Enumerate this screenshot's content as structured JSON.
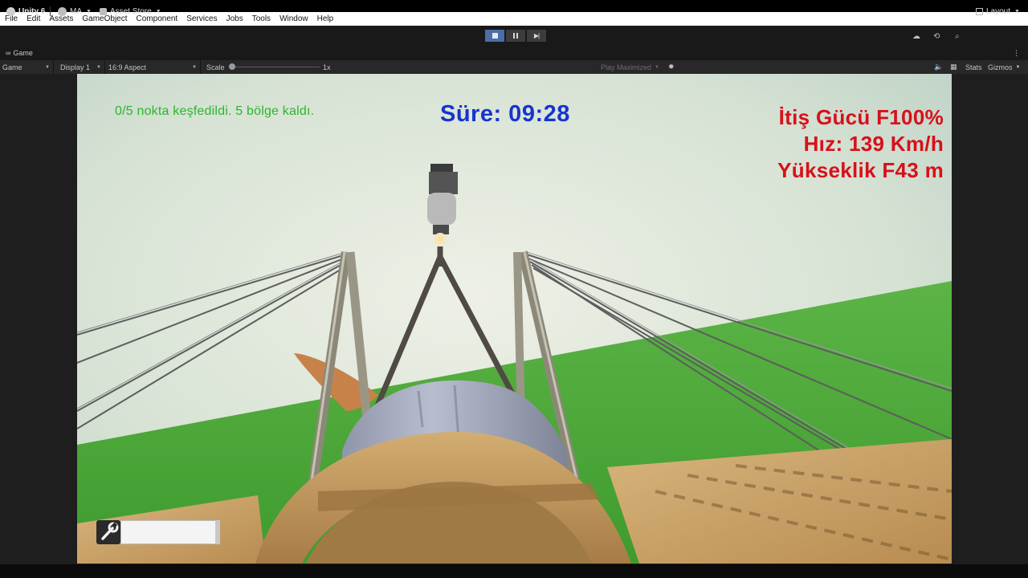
{
  "menu": {
    "items": [
      "File",
      "Edit",
      "Assets",
      "GameObject",
      "Component",
      "Services",
      "Jobs",
      "Tools",
      "Window",
      "Help"
    ]
  },
  "toolbar": {
    "unity_label": "Unity 6",
    "account_label": "MA",
    "asset_store_label": "Asset Store",
    "layout_label": "Layout",
    "play_state": "playing"
  },
  "game_tab": {
    "label": "Game"
  },
  "game_controls": {
    "view_mode": "Game",
    "display": "Display 1",
    "aspect": "16:9 Aspect",
    "scale_label": "Scale",
    "scale_value": "1x",
    "play_mode": "Play Maximized",
    "stats_label": "Stats",
    "gizmos_label": "Gizmos"
  },
  "hud": {
    "discovered_text": "0/5 nokta keşfedildi. 5 bölge kaldı.",
    "timer_text": "Süre: 09:28",
    "thrust_text": "İtiş Gücü F100%",
    "speed_text": "Hız: 139 Km/h",
    "altitude_text": "Yükseklik F43 m",
    "repair_level": 0.0
  },
  "colors": {
    "hud_green": "#2db52d",
    "hud_blue": "#1634d0",
    "hud_red": "#d8101a",
    "sky": "#d9e3d6",
    "ground": "#4eaa37",
    "play_button_active": "#4b6ea8"
  },
  "icons": {
    "unity_logo": "unity-logo-icon",
    "account": "account-icon",
    "asset_store": "asset-store-icon",
    "cloud": "cloud-icon",
    "history": "history-icon",
    "search": "search-icon",
    "layout": "layout-icon",
    "audio": "speaker-icon",
    "repair": "wrench-icon"
  }
}
